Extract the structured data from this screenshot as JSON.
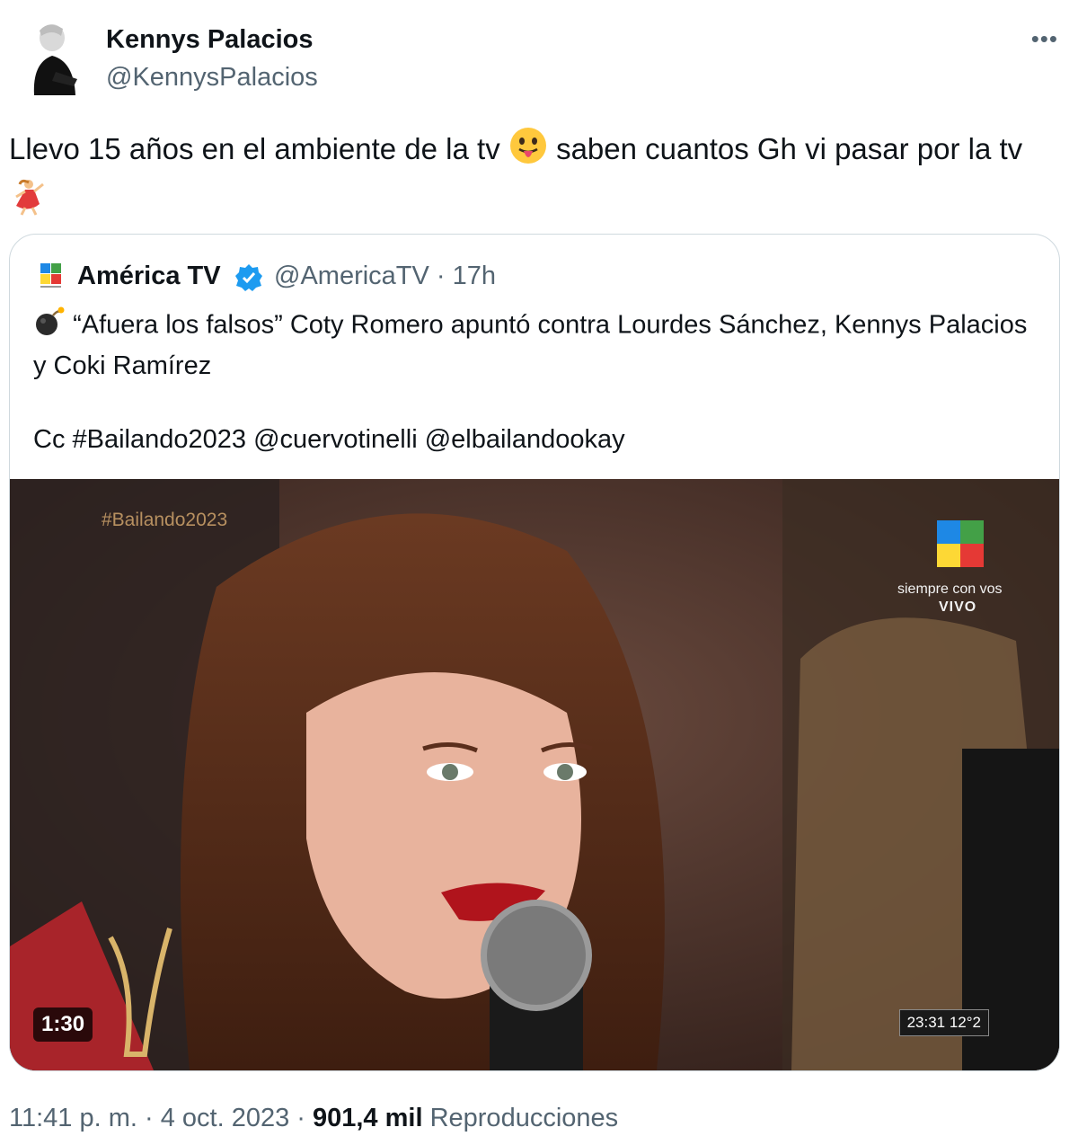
{
  "author": {
    "name": "Kennys Palacios",
    "handle": "@KennysPalacios"
  },
  "more_label": "•••",
  "tweet": {
    "text_part1": "Llevo 15 años en el ambiente de la tv",
    "text_part2": "saben cuantos Gh vi pasar por la tv",
    "emoji1": "face-with-tongue-icon",
    "emoji2": "dancer-icon"
  },
  "quoted": {
    "name": "América TV",
    "handle_time": "@AmericaTV · 17h",
    "line1": "“Afuera los falsos” Coty Romero apuntó contra Lourdes Sánchez, Kennys Palacios y Coki Ramírez",
    "line2": "Cc #Bailando2023 @cuervotinelli @elbailandookay",
    "verified_color": "#1d9bf0",
    "video": {
      "duration": "1:30",
      "overlay_hashtag": "#Bailando2023",
      "overlay_slogan": "siempre con vos",
      "overlay_live": "VIVO",
      "overlay_clock": "23:31  12°2"
    }
  },
  "footer": {
    "time_date": "11:41 p. m. · 4 oct. 2023 · ",
    "views_count": "901,4 mil",
    "views_label": "Reproducciones"
  }
}
